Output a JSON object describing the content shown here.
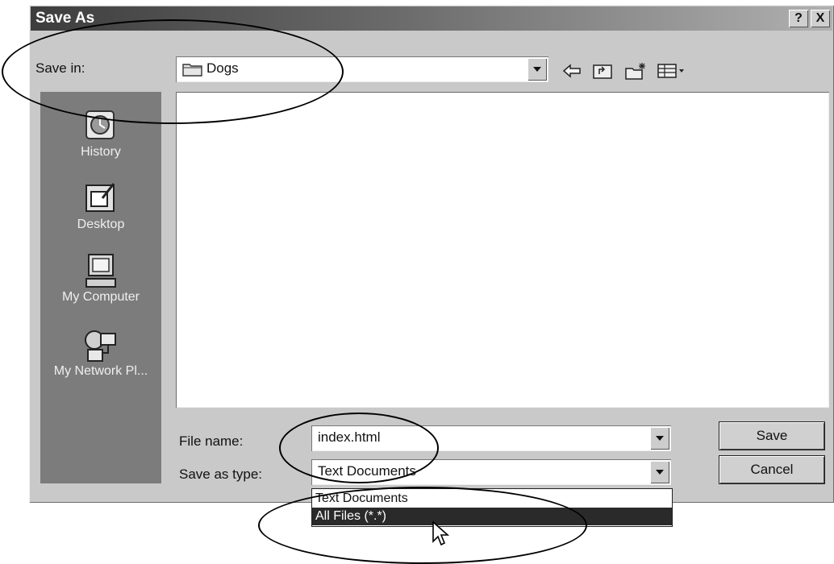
{
  "dialog": {
    "title": "Save As",
    "help_button": "?",
    "close_button": "X"
  },
  "save_in": {
    "label": "Save in:",
    "value": "Dogs"
  },
  "toolbar": {
    "icons": [
      "back-arrow-icon",
      "up-folder-icon",
      "new-folder-icon",
      "view-menu-icon"
    ]
  },
  "places": [
    {
      "label": "History",
      "icon": "history-icon"
    },
    {
      "label": "Desktop",
      "icon": "desktop-icon"
    },
    {
      "label": "My Computer",
      "icon": "my-computer-icon"
    },
    {
      "label": "My Network Pl...",
      "icon": "network-places-icon"
    }
  ],
  "file_name": {
    "label": "File name:",
    "value": "index.html"
  },
  "save_as_type": {
    "label": "Save as type:",
    "value": "Text Documents",
    "options": [
      "Text Documents",
      "All Files (*.*)"
    ],
    "highlighted_option": "All Files (*.*)"
  },
  "buttons": {
    "save": "Save",
    "cancel": "Cancel"
  },
  "colors": {
    "dialog_bg": "#c9c9c9",
    "places_bar_bg": "#7c7c7c",
    "selected_option_bg": "#2a2a2a"
  }
}
